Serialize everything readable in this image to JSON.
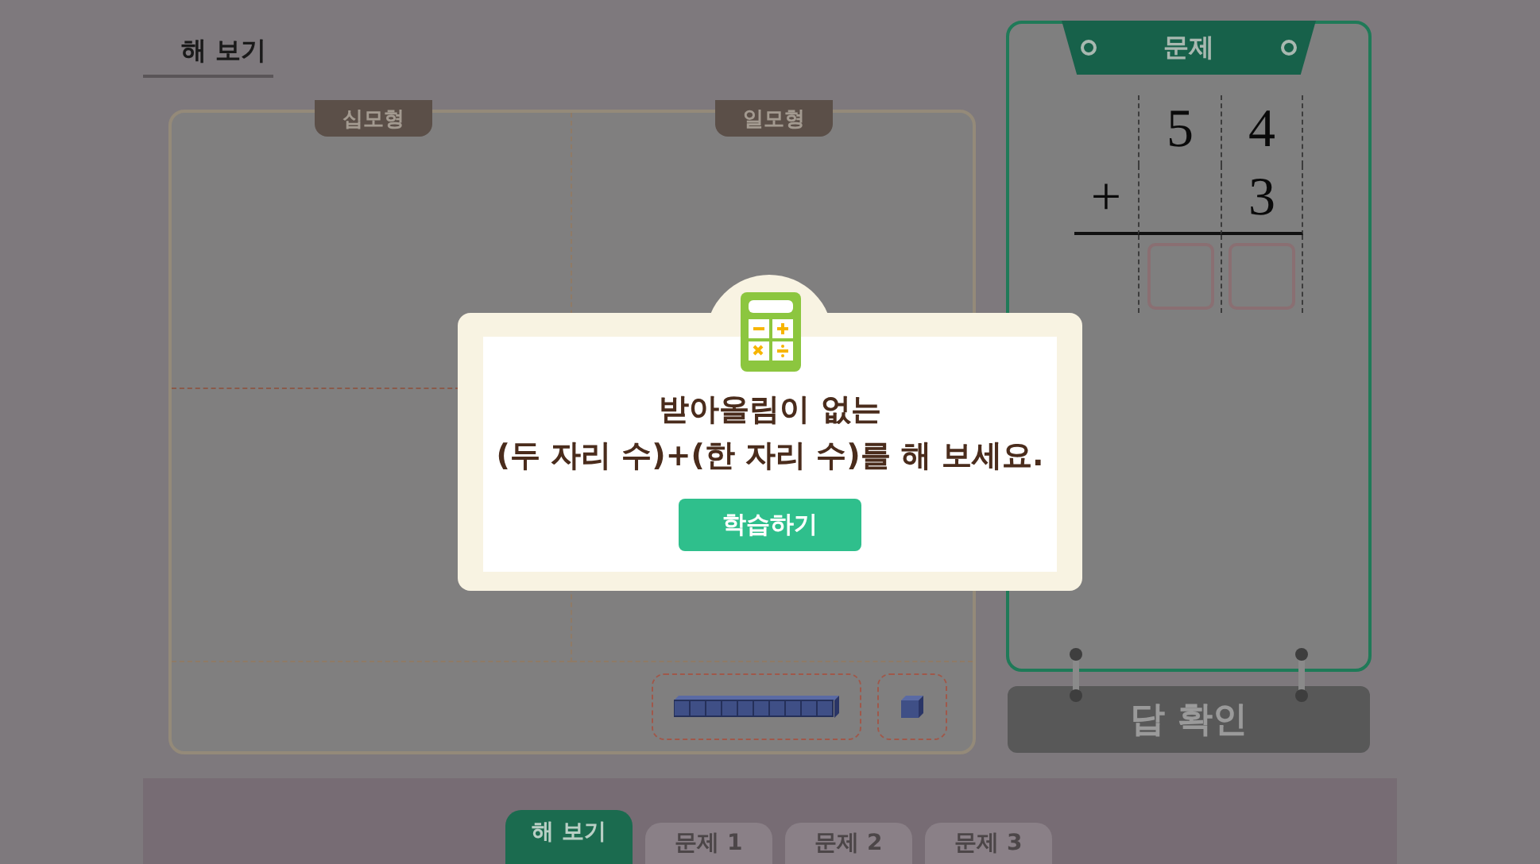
{
  "page_title": "해 보기",
  "board": {
    "columns": [
      {
        "label": "십모형"
      },
      {
        "label": "일모형"
      }
    ]
  },
  "problem": {
    "title": "문제",
    "addend_1": [
      "5",
      "4"
    ],
    "operator": "+",
    "addend_2": [
      "3"
    ]
  },
  "check_button": {
    "label": "답 확인",
    "disabled": true
  },
  "tabs": [
    {
      "label": "해 보기",
      "selected": true
    },
    {
      "label": "문제 1",
      "selected": false
    },
    {
      "label": "문제 2",
      "selected": false
    },
    {
      "label": "문제 3",
      "selected": false
    }
  ],
  "dialog": {
    "message": "받아올림이 없는\n(두 자리 수)+(한 자리 수)를 해 보세요.",
    "button": "학습하기"
  }
}
